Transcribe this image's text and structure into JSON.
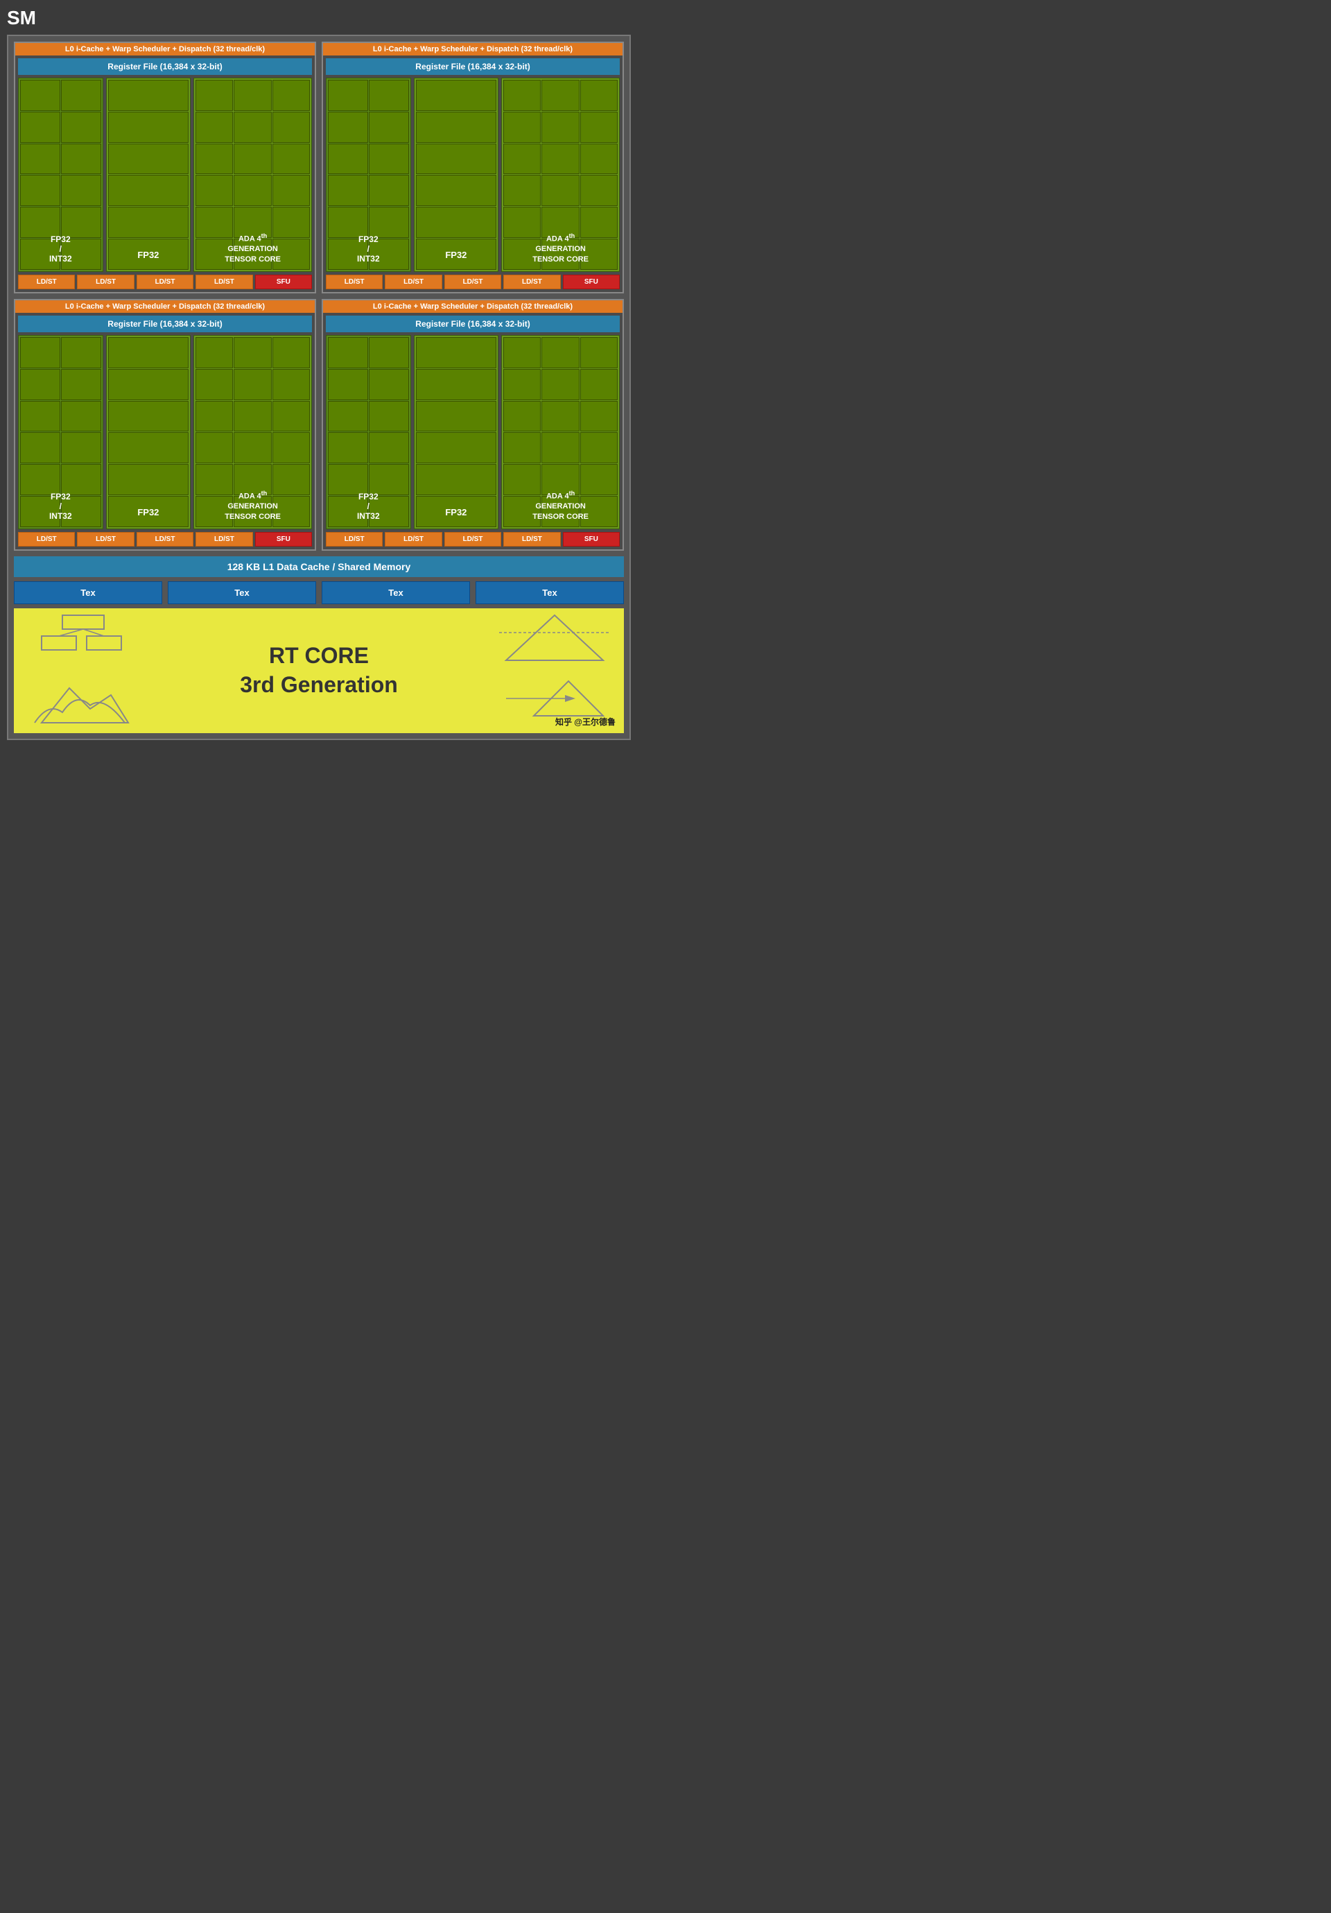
{
  "title": "SM",
  "warp_header": "L0 i-Cache + Warp Scheduler + Dispatch (32 thread/clk)",
  "reg_file": "Register File (16,384 x 32-bit)",
  "compute": {
    "fp32_int32_label": "FP32\n/\nINT32",
    "fp32_label": "FP32",
    "tensor_label": "ADA 4th GENERATION TENSOR CORE"
  },
  "bottom_buttons": [
    "LD/ST",
    "LD/ST",
    "LD/ST",
    "LD/ST",
    "SFU"
  ],
  "l1_cache": "128 KB L1 Data Cache / Shared Memory",
  "tex_labels": [
    "Tex",
    "Tex",
    "Tex",
    "Tex"
  ],
  "rt_core_text": "RT CORE\n3rd Generation",
  "watermark": "知乎 @王尔德鲁"
}
